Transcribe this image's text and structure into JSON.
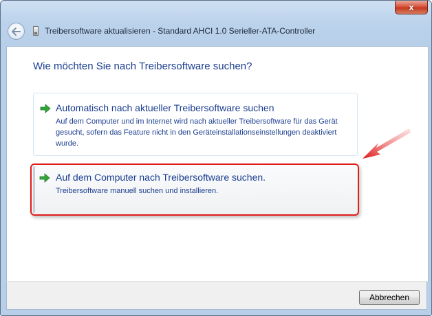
{
  "window": {
    "title": "Treibersoftware aktualisieren - Standard AHCI 1.0 Serieller-ATA-Controller",
    "close_label": "x"
  },
  "main": {
    "heading": "Wie möchten Sie nach Treibersoftware suchen?",
    "options": [
      {
        "title": "Automatisch nach aktueller Treibersoftware suchen",
        "description": "Auf dem Computer und im Internet wird nach aktueller Treibersoftware für das Gerät gesucht, sofern das Feature nicht in den Geräteinstallationseinstellungen deaktiviert wurde."
      },
      {
        "title": "Auf dem Computer nach Treibersoftware suchen.",
        "description": "Treibersoftware manuell suchen und installieren."
      }
    ]
  },
  "footer": {
    "cancel_label": "Abbrechen"
  },
  "colors": {
    "accent_text": "#1a3d8f",
    "highlight": "#e21b1b",
    "arrow_green": "#35a53a"
  },
  "icons": {
    "back": "back-arrow-icon",
    "option": "green-arrow-icon",
    "device": "device-icon",
    "annotation": "red-pointer-arrow-icon"
  }
}
